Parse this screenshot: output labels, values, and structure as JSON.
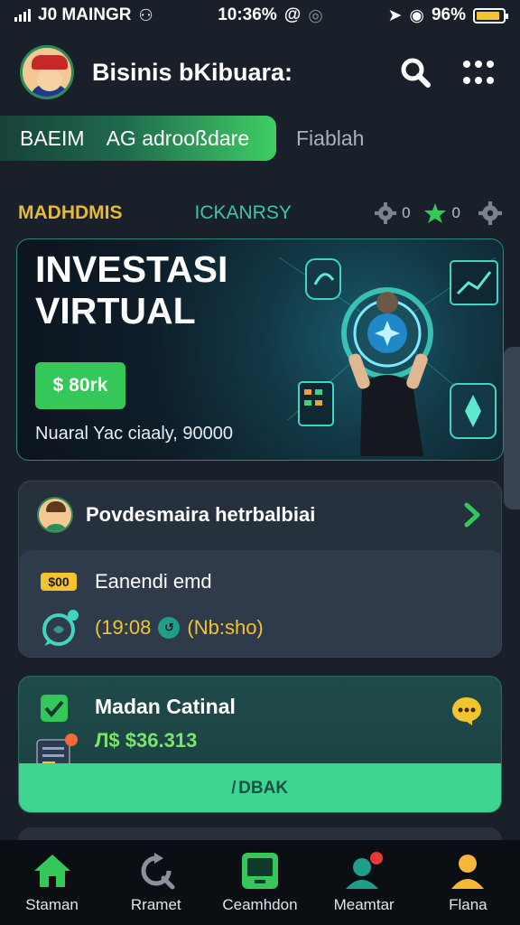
{
  "status_bar": {
    "carrier": "J0 MAINGR",
    "time": "10:36%",
    "battery": "96%",
    "battery_level": 0.9
  },
  "header": {
    "title": "Bisinis bKibuara:",
    "icons": [
      "avatar",
      "search-icon",
      "grid-menu-icon"
    ]
  },
  "tabs": {
    "active_a": "BAEIM",
    "active_b": "AG adrooßdare",
    "other": "Fiablah"
  },
  "section": {
    "left": "MADHDMIS",
    "center": "ICKANRSY",
    "gear_count": "0",
    "star_count": "0"
  },
  "hero": {
    "title_line1": "INVESTASI",
    "title_line2": "VIRTUAL",
    "button_label": "$ 80rk",
    "subtitle": "Nuaral Yac ciaaly, 90000"
  },
  "card1": {
    "title": "Povdesmaira hetrbalbiai",
    "badge": "$00",
    "event": "Eanendi emd",
    "time_left": "(19:08",
    "time_right": "(Nb:sho)"
  },
  "card2": {
    "title": "Madan Catinal",
    "amount": "Л$ $36.313",
    "button_label": "̸ DBAK"
  },
  "bottom_nav": [
    {
      "label": "Staman",
      "icon": "home-icon"
    },
    {
      "label": "Rramet",
      "icon": "refresh-icon"
    },
    {
      "label": "Ceamhdon",
      "icon": "monitor-icon"
    },
    {
      "label": "Meamtar",
      "icon": "user-badge-icon"
    },
    {
      "label": "Flana",
      "icon": "profile-icon"
    }
  ],
  "colors": {
    "background": "#1a2029",
    "accent_green": "#34c759",
    "accent_yellow": "#f4c430",
    "teal": "#3ed590",
    "nav_bg": "#0b0e13"
  }
}
